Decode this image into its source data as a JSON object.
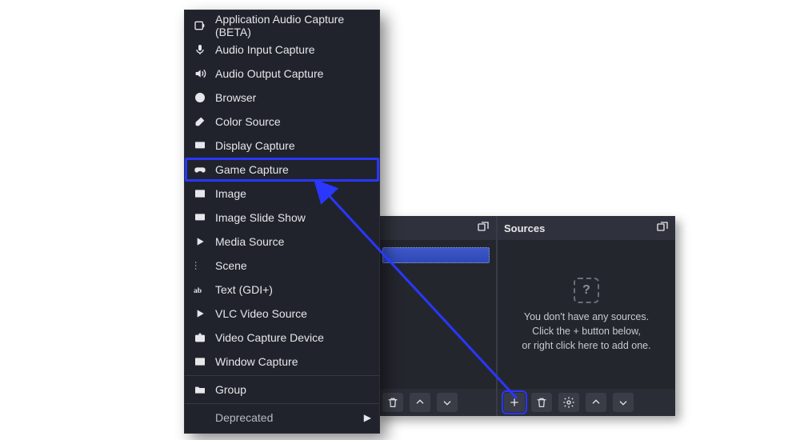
{
  "menu": {
    "items": [
      {
        "icon": "app-audio",
        "label": "Application Audio Capture (BETA)"
      },
      {
        "icon": "mic",
        "label": "Audio Input Capture"
      },
      {
        "icon": "speaker",
        "label": "Audio Output Capture"
      },
      {
        "icon": "globe",
        "label": "Browser"
      },
      {
        "icon": "brush",
        "label": "Color Source"
      },
      {
        "icon": "monitor",
        "label": "Display Capture"
      },
      {
        "icon": "gamepad",
        "label": "Game Capture",
        "highlighted": true
      },
      {
        "icon": "image",
        "label": "Image"
      },
      {
        "icon": "slideshow",
        "label": "Image Slide Show"
      },
      {
        "icon": "play",
        "label": "Media Source"
      },
      {
        "icon": "list",
        "label": "Scene"
      },
      {
        "icon": "text",
        "label": "Text (GDI+)"
      },
      {
        "icon": "play",
        "label": "VLC Video Source"
      },
      {
        "icon": "camera",
        "label": "Video Capture Device"
      },
      {
        "icon": "window",
        "label": "Window Capture"
      }
    ],
    "group_label": "Group",
    "deprecated_label": "Deprecated"
  },
  "sources_panel": {
    "title": "Sources",
    "empty_line1": "You don't have any sources.",
    "empty_line2": "Click the + button below,",
    "empty_line3": "or right click here to add one."
  },
  "annotation_arrow": {
    "from": "add-source-button",
    "to": "menu-item-game-capture"
  },
  "colors": {
    "highlight": "#2937ff",
    "panel_bg": "#24262e",
    "menu_bg": "#20232b"
  }
}
